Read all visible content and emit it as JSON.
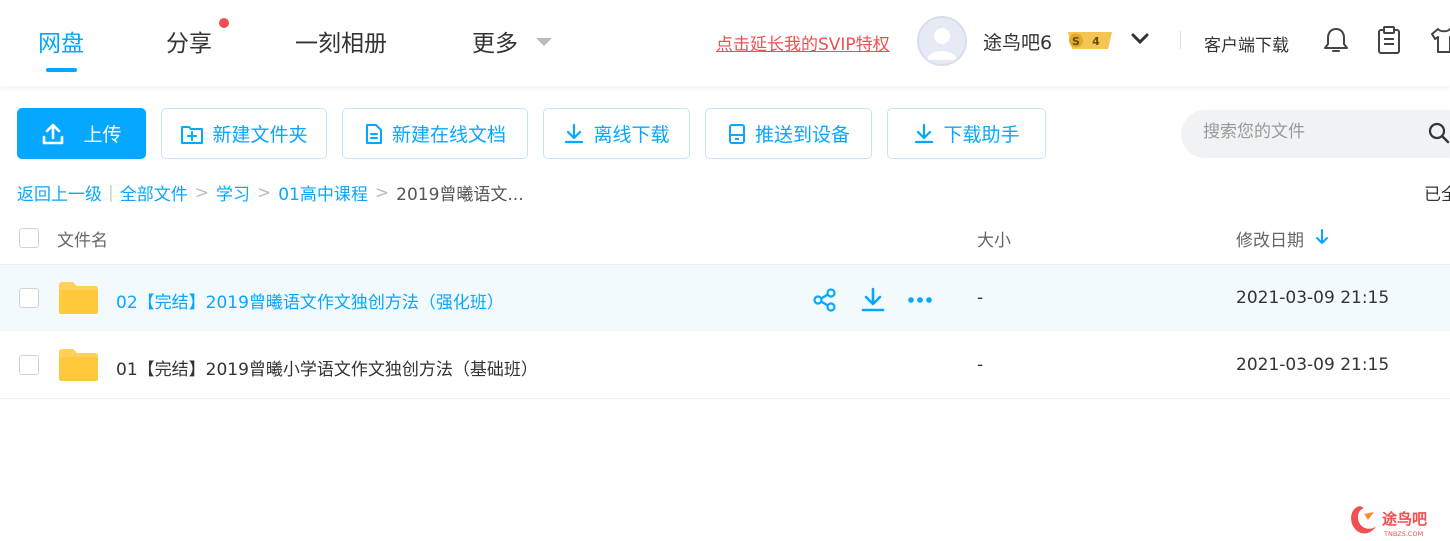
{
  "nav": {
    "items": [
      {
        "label": "网盘"
      },
      {
        "label": "分享"
      },
      {
        "label": "一刻相册"
      },
      {
        "label": "更多"
      }
    ]
  },
  "header": {
    "svip_link": "点击延长我的SVIP特权",
    "username": "途鸟吧6",
    "badge_letter": "S",
    "badge_level": "4",
    "client_download": "客户端下载"
  },
  "toolbar": {
    "upload": "上传",
    "new_folder": "新建文件夹",
    "new_doc": "新建在线文档",
    "offline_download": "离线下载",
    "push_device": "推送到设备",
    "download_helper": "下载助手",
    "search_placeholder": "搜索您的文件"
  },
  "breadcrumb": {
    "back": "返回上一级",
    "items": [
      "全部文件",
      "学习",
      "01高中课程"
    ],
    "current": "2019曾曦语文...",
    "loaded": "已全"
  },
  "table": {
    "columns": [
      "文件名",
      "大小",
      "修改日期"
    ],
    "rows": [
      {
        "name": "02【完结】2019曾曦语文作文独创方法（强化班）",
        "size": "-",
        "date": "2021-03-09 21:15"
      },
      {
        "name": "01【完结】2019曾曦小学语文作文独创方法（基础班）",
        "size": "-",
        "date": "2021-03-09 21:15"
      }
    ]
  },
  "watermark": {
    "text": "途鸟吧",
    "sub": "TNBZS.COM"
  },
  "colors": {
    "accent": "#06a7ff",
    "svip_red": "#f0504f",
    "folder": "#ffd15b"
  }
}
